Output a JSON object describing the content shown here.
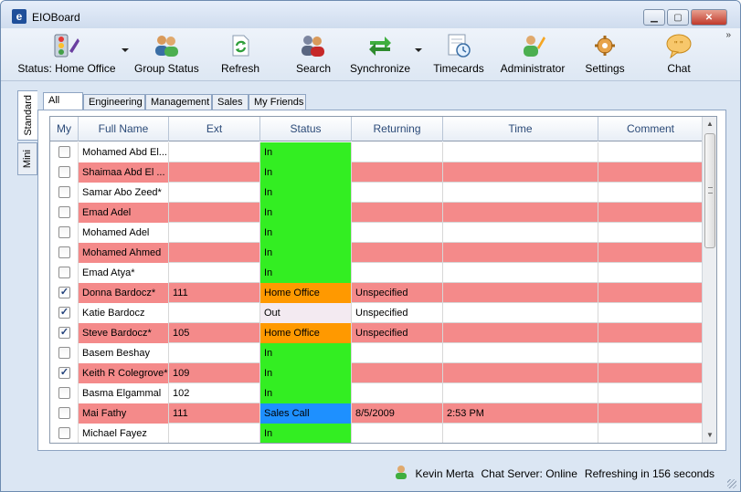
{
  "window": {
    "title": "EIOBoard",
    "app_icon_glyph": "e"
  },
  "toolbar": {
    "items": [
      {
        "label": "Status: Home Office",
        "icon": "status-traffic-light-icon",
        "has_dropdown": true
      },
      {
        "label": "Group Status",
        "icon": "group-people-icon",
        "has_dropdown": false
      },
      {
        "label": "Refresh",
        "icon": "refresh-icon",
        "has_dropdown": false
      },
      {
        "label": "Search",
        "icon": "search-people-icon",
        "has_dropdown": false
      },
      {
        "label": "Synchronize",
        "icon": "synchronize-arrows-icon",
        "has_dropdown": true
      },
      {
        "label": "Timecards",
        "icon": "timecard-clock-icon",
        "has_dropdown": false
      },
      {
        "label": "Administrator",
        "icon": "administrator-icon",
        "has_dropdown": false
      },
      {
        "label": "Settings",
        "icon": "settings-gear-icon",
        "has_dropdown": false
      },
      {
        "label": "Chat",
        "icon": "chat-bubble-icon",
        "has_dropdown": false
      }
    ],
    "more_glyph": "»"
  },
  "side_tabs": [
    {
      "label": "Standard",
      "active": true
    },
    {
      "label": "Mini",
      "active": false
    }
  ],
  "group_tabs": [
    {
      "label": "All",
      "active": true
    },
    {
      "label": "Engineering",
      "active": false
    },
    {
      "label": "Management",
      "active": false
    },
    {
      "label": "Sales",
      "active": false
    },
    {
      "label": "My Friends",
      "active": false
    }
  ],
  "grid": {
    "columns": [
      "My",
      "Full Name",
      "Ext",
      "Status",
      "Returning",
      "Time",
      "Comment"
    ],
    "rows": [
      {
        "my": false,
        "name": "Mohamed Abd El...",
        "ext": "",
        "status": "In",
        "returning": "",
        "time": "",
        "comment": "",
        "highlight": false,
        "status_color": "#33ee22"
      },
      {
        "my": false,
        "name": "Shaimaa Abd El ...",
        "ext": "",
        "status": "In",
        "returning": "",
        "time": "",
        "comment": "",
        "highlight": true,
        "status_color": "#33ee22"
      },
      {
        "my": false,
        "name": "Samar Abo Zeed*",
        "ext": "",
        "status": "In",
        "returning": "",
        "time": "",
        "comment": "",
        "highlight": false,
        "status_color": "#33ee22"
      },
      {
        "my": false,
        "name": "Emad Adel",
        "ext": "",
        "status": "In",
        "returning": "",
        "time": "",
        "comment": "",
        "highlight": true,
        "status_color": "#33ee22"
      },
      {
        "my": false,
        "name": "Mohamed Adel",
        "ext": "",
        "status": "In",
        "returning": "",
        "time": "",
        "comment": "",
        "highlight": false,
        "status_color": "#33ee22"
      },
      {
        "my": false,
        "name": "Mohamed Ahmed",
        "ext": "",
        "status": "In",
        "returning": "",
        "time": "",
        "comment": "",
        "highlight": true,
        "status_color": "#33ee22"
      },
      {
        "my": false,
        "name": "Emad Atya*",
        "ext": "",
        "status": "In",
        "returning": "",
        "time": "",
        "comment": "",
        "highlight": false,
        "status_color": "#33ee22"
      },
      {
        "my": true,
        "name": "Donna Bardocz*",
        "ext": "111",
        "status": "Home Office",
        "returning": "Unspecified",
        "time": "",
        "comment": "",
        "highlight": true,
        "status_color": "#ff9900"
      },
      {
        "my": true,
        "name": "Katie Bardocz",
        "ext": "",
        "status": "Out",
        "returning": "Unspecified",
        "time": "",
        "comment": "",
        "highlight": false,
        "status_color": "#f3eaf1"
      },
      {
        "my": true,
        "name": "Steve Bardocz*",
        "ext": "105",
        "status": "Home Office",
        "returning": "Unspecified",
        "time": "",
        "comment": "",
        "highlight": true,
        "status_color": "#ff9900"
      },
      {
        "my": false,
        "name": "Basem Beshay",
        "ext": "",
        "status": "In",
        "returning": "",
        "time": "",
        "comment": "",
        "highlight": false,
        "status_color": "#33ee22"
      },
      {
        "my": true,
        "name": "Keith R Colegrove*",
        "ext": "109",
        "status": "In",
        "returning": "",
        "time": "",
        "comment": "",
        "highlight": true,
        "status_color": "#33ee22"
      },
      {
        "my": false,
        "name": "Basma Elgammal",
        "ext": "102",
        "status": "In",
        "returning": "",
        "time": "",
        "comment": "",
        "highlight": false,
        "status_color": "#33ee22"
      },
      {
        "my": false,
        "name": "Mai Fathy",
        "ext": "111",
        "status": "Sales Call",
        "returning": "8/5/2009",
        "time": "2:53 PM",
        "comment": "",
        "highlight": true,
        "status_color": "#1e90ff"
      },
      {
        "my": false,
        "name": "Michael Fayez",
        "ext": "",
        "status": "In",
        "returning": "",
        "time": "",
        "comment": "",
        "highlight": false,
        "status_color": "#33ee22"
      }
    ]
  },
  "statusbar": {
    "user": "Kevin Merta",
    "chat_server": "Chat Server: Online",
    "refreshing": "Refreshing in 156 seconds"
  },
  "colors": {
    "highlight_row": "#f48a8a",
    "normal_row": "#ffffff",
    "header_text": "#2b4a78"
  }
}
